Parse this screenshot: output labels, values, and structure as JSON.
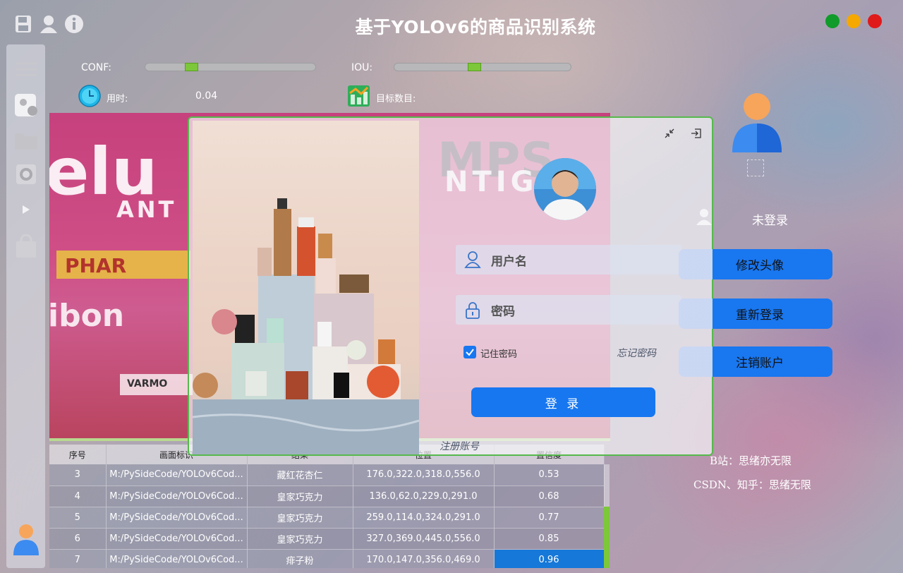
{
  "header": {
    "title": "基于YOLOv6的商品识别系统",
    "window_colors": {
      "close": "#e0191b",
      "minimize": "#f5a800",
      "maximize": "#119b2a"
    }
  },
  "controls": {
    "conf_label": "CONF:",
    "iou_label": "IOU:",
    "conf_value": 0.25,
    "iou_value": 0.45,
    "time_label": "用时:",
    "time_value": "0.04",
    "target_label": "目标数目:",
    "target_value": ""
  },
  "sidebar": {
    "items": [
      "menu-icon",
      "image-icon",
      "folder-icon",
      "camera-icon",
      "play-icon",
      "bag-icon"
    ]
  },
  "table": {
    "headers": [
      "序号",
      "画面标识",
      "结果",
      "位置",
      "置信度"
    ],
    "rows": [
      {
        "id": "3",
        "path": "M:/PySideCode/YOLOv6Cod...",
        "result": "藏红花杏仁",
        "box": "176.0,322.0,318.0,556.0",
        "conf": "0.53"
      },
      {
        "id": "4",
        "path": "M:/PySideCode/YOLOv6Cod...",
        "result": "皇家巧克力",
        "box": "136.0,62.0,229.0,291.0",
        "conf": "0.68"
      },
      {
        "id": "5",
        "path": "M:/PySideCode/YOLOv6Cod...",
        "result": "皇家巧克力",
        "box": "259.0,114.0,324.0,291.0",
        "conf": "0.77"
      },
      {
        "id": "6",
        "path": "M:/PySideCode/YOLOv6Cod...",
        "result": "皇家巧克力",
        "box": "327.0,369.0,445.0,556.0",
        "conf": "0.85"
      },
      {
        "id": "7",
        "path": "M:/PySideCode/YOLOv6Cod...",
        "result": "痱子粉",
        "box": "170.0,147.0,356.0,469.0",
        "conf": "0.96"
      }
    ]
  },
  "login": {
    "username_placeholder": "用户名",
    "password_placeholder": "密码",
    "remember_label": "记住密码",
    "remember_checked": true,
    "forgot_label": "忘记密码",
    "login_label": "登 录",
    "register_label": "注册账号"
  },
  "user_panel": {
    "status": "未登录",
    "buttons": {
      "change_avatar": "修改头像",
      "relogin": "重新登录",
      "logout": "注销账户"
    }
  },
  "credits": {
    "bilibili": "B站：思绪亦无限",
    "csdn": "CSDN、知乎：思绪无限"
  },
  "colors": {
    "accent": "#1777f0",
    "slider": "#7cc73a",
    "dialog_border": "#56b94c"
  }
}
